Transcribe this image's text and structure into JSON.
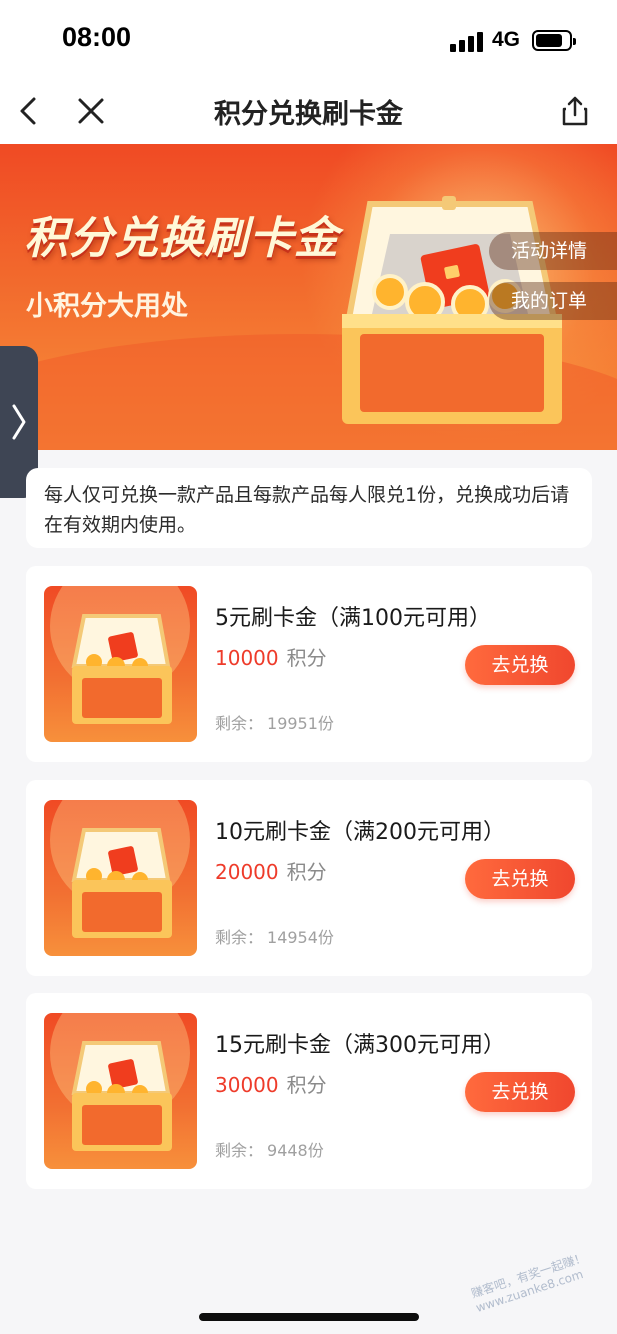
{
  "status_bar": {
    "time": "08:00",
    "network": "4G"
  },
  "nav": {
    "title": "积分兑换刷卡金"
  },
  "banner": {
    "title": "积分兑换刷卡金",
    "subtitle": "小积分大用处",
    "activity_details": "活动详情",
    "my_orders": "我的订单"
  },
  "notice": {
    "text": "每人仅可兑换一款产品且每款产品每人限兑1份，兑换成功后请在有效期内使用。"
  },
  "products": [
    {
      "title": "5元刷卡金（满100元可用）",
      "points": "10000",
      "points_unit": "积分",
      "remain_label": "剩余：",
      "remain_value": "19951份",
      "button": "去兑换"
    },
    {
      "title": "10元刷卡金（满200元可用）",
      "points": "20000",
      "points_unit": "积分",
      "remain_label": "剩余：",
      "remain_value": "14954份",
      "button": "去兑换"
    },
    {
      "title": "15元刷卡金（满300元可用）",
      "points": "30000",
      "points_unit": "积分",
      "remain_label": "剩余：",
      "remain_value": "9448份",
      "button": "去兑换"
    }
  ],
  "watermark": "赚客吧，有奖一起赚！ www.zuanke8.com",
  "icons": {
    "back": "chevron-left-icon",
    "close": "close-icon",
    "share": "share-icon",
    "side_expand": "chevron-right-icon"
  },
  "colors": {
    "accent": "#f0472e",
    "points_red": "#ee3b2a",
    "banner_orange": "#f26a2d"
  }
}
